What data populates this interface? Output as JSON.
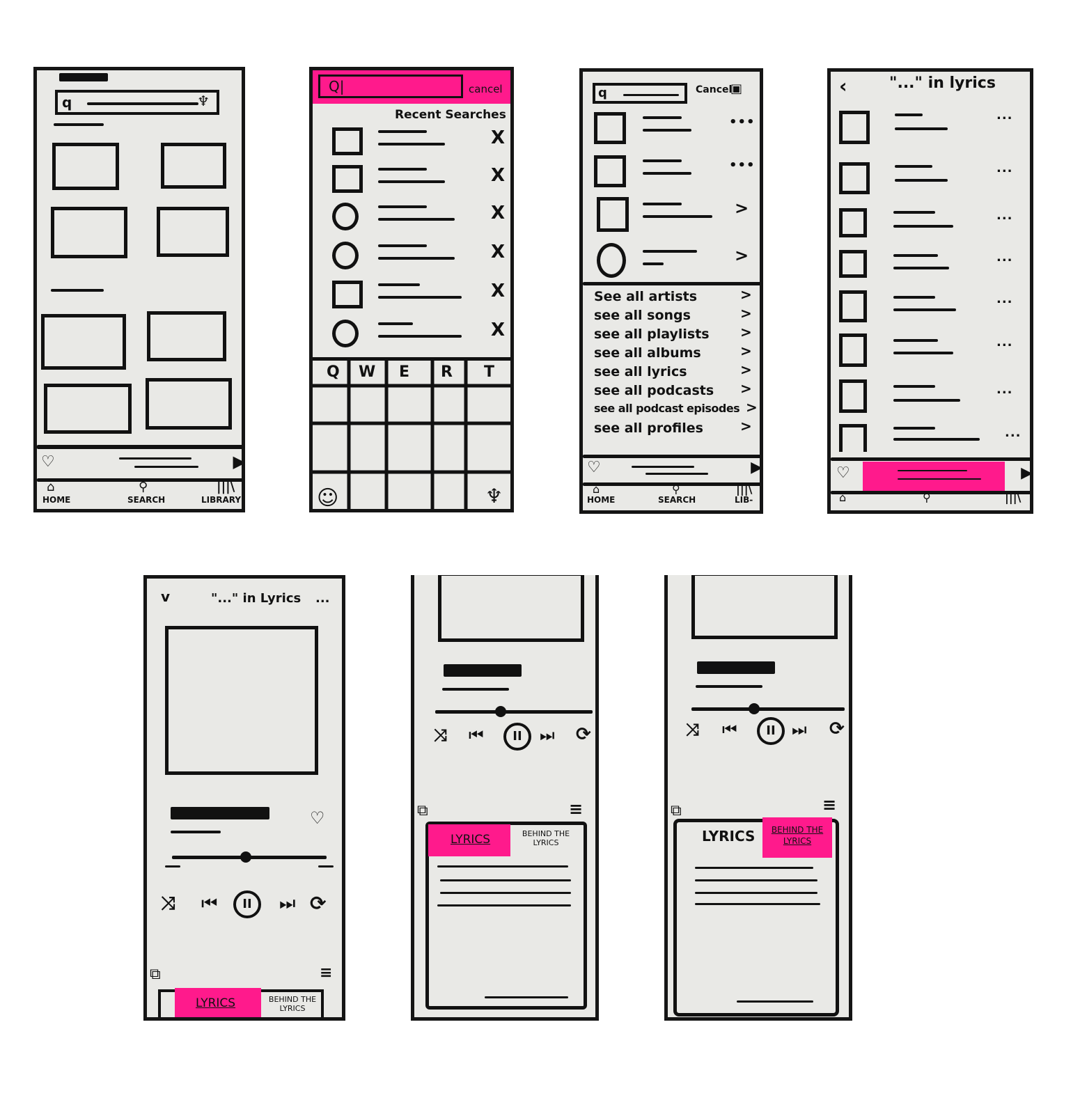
{
  "screen1": {
    "tabs": [
      {
        "label": "HOME"
      },
      {
        "label": "SEARCH"
      },
      {
        "label": "LIBRARY"
      }
    ]
  },
  "screen2": {
    "search_value": "Q|",
    "cancel_label": "cancel",
    "section_title": "Recent Searches",
    "remove_glyph": "X",
    "keyboard_keys": [
      "Q",
      "W",
      "E",
      "R",
      "T"
    ]
  },
  "screen3": {
    "cancel_label": "Cancel",
    "see_all": [
      "See all artists",
      "see all songs",
      "see all playlists",
      "see all albums",
      "see all lyrics",
      "see all podcasts",
      "see all podcast episodes",
      "see all profiles"
    ],
    "tabs": [
      {
        "label": "HOME"
      },
      {
        "label": "SEARCH"
      },
      {
        "label": "LIB-"
      }
    ]
  },
  "screen4": {
    "title": "\"...\" in lyrics",
    "more_glyph": "..."
  },
  "screen5": {
    "title": "\"...\" in Lyrics",
    "more_glyph": "...",
    "lyrics_tab": "LYRICS",
    "behind_tab": "BEHIND THE LYRICS"
  },
  "screen6": {
    "lyrics_tab": "LYRICS",
    "behind_tab": "BEHIND THE LYRICS"
  },
  "screen7": {
    "lyrics_tab": "LYRICS",
    "behind_tab": "BEHIND THE LYRICS"
  },
  "colors": {
    "paper": "#e9e9e6",
    "ink": "#111111",
    "highlight": "#ff1a8c"
  }
}
